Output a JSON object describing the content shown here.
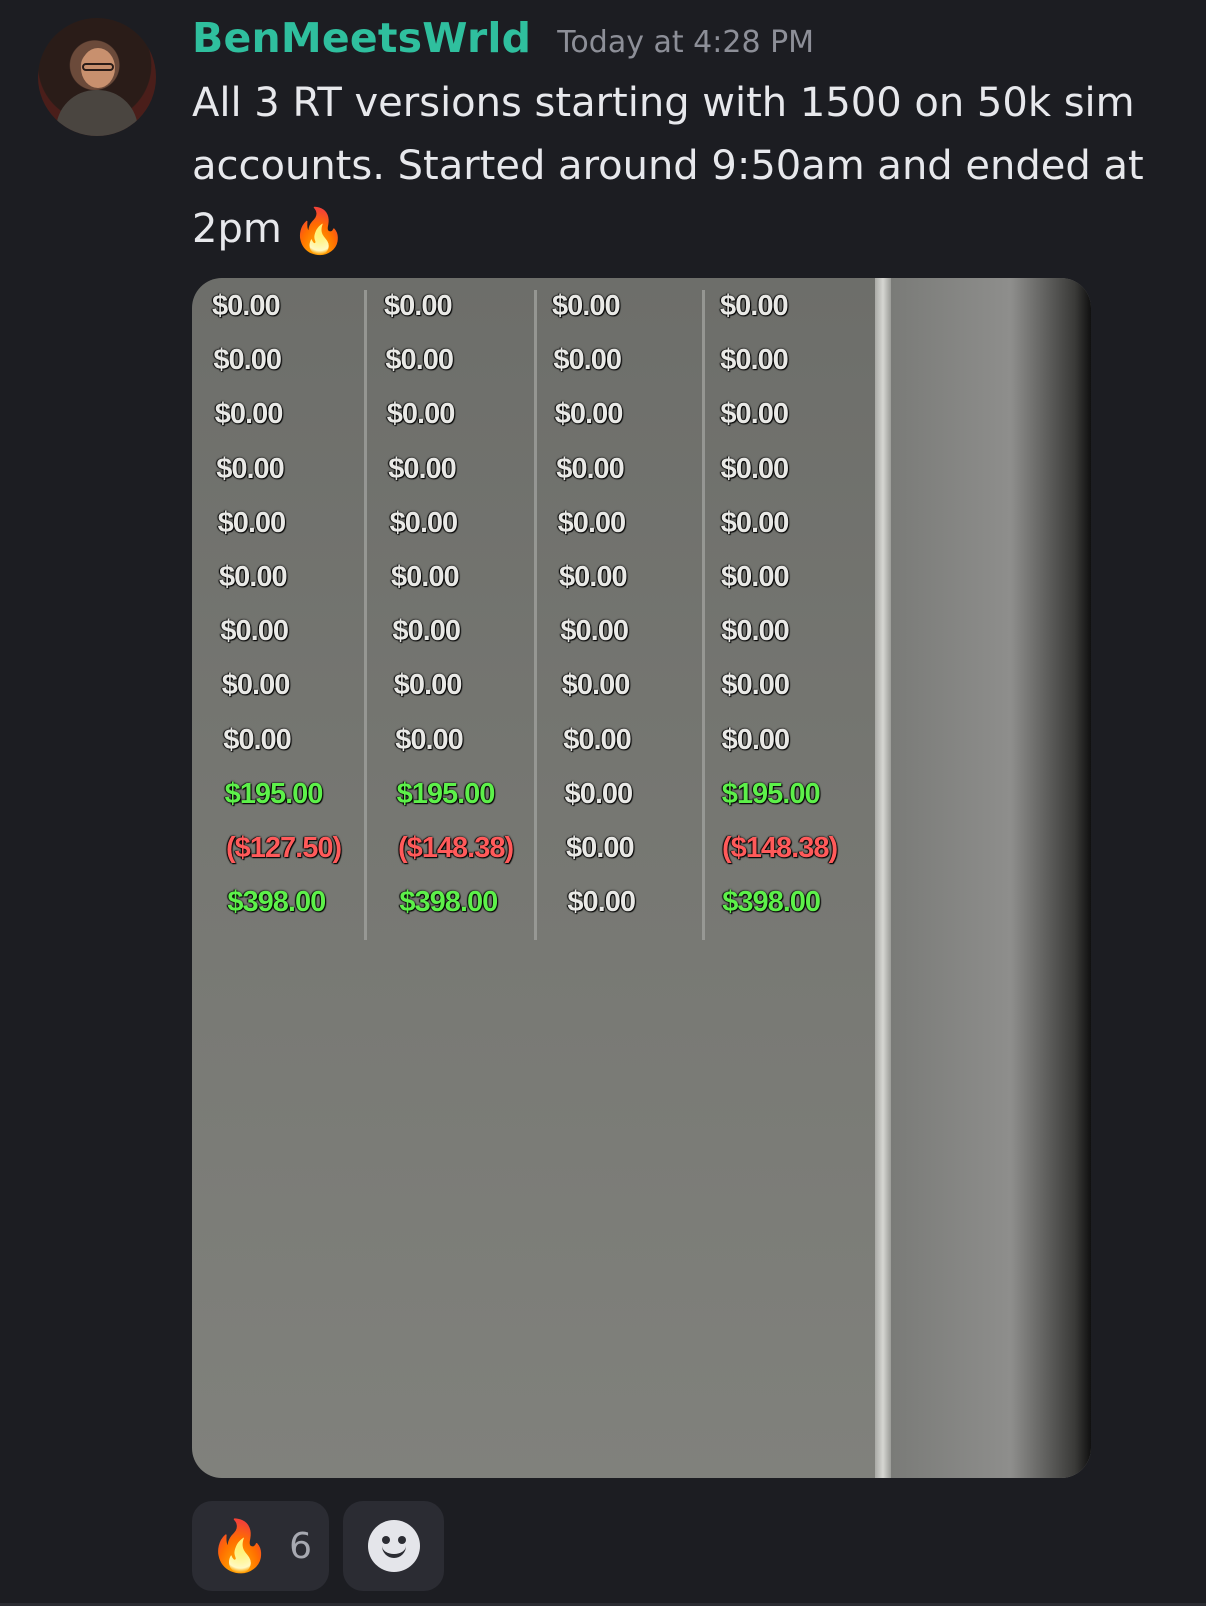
{
  "message": {
    "username": "BenMeetsWrld",
    "timestamp": "Today at 4:28 PM",
    "text": "All 3 RT versions starting with 1500 on 50k sim accounts. Started around 9:50am and ended at 2pm",
    "text_emoji": "🔥"
  },
  "attachment": {
    "columns": [
      [
        "$0.00",
        "$0.00",
        "$0.00",
        "$0.00",
        "$0.00",
        "$0.00",
        "$0.00",
        "$0.00",
        "$0.00",
        "$195.00",
        "($127.50)",
        "$398.00"
      ],
      [
        "$0.00",
        "$0.00",
        "$0.00",
        "$0.00",
        "$0.00",
        "$0.00",
        "$0.00",
        "$0.00",
        "$0.00",
        "$195.00",
        "($148.38)",
        "$398.00"
      ],
      [
        "$0.00",
        "$0.00",
        "$0.00",
        "$0.00",
        "$0.00",
        "$0.00",
        "$0.00",
        "$0.00",
        "$0.00",
        "$0.00",
        "$0.00",
        "$0.00"
      ],
      [
        "$0.00",
        "$0.00",
        "$0.00",
        "$0.00",
        "$0.00",
        "$0.00",
        "$0.00",
        "$0.00",
        "$0.00",
        "$195.00",
        "($148.38)",
        "$398.00"
      ]
    ]
  },
  "reactions": [
    {
      "emoji": "🔥",
      "count": "6"
    }
  ],
  "colors": {
    "username": "#2fbf9e",
    "positive": "#5df04a",
    "negative": "#ff5a5a"
  }
}
